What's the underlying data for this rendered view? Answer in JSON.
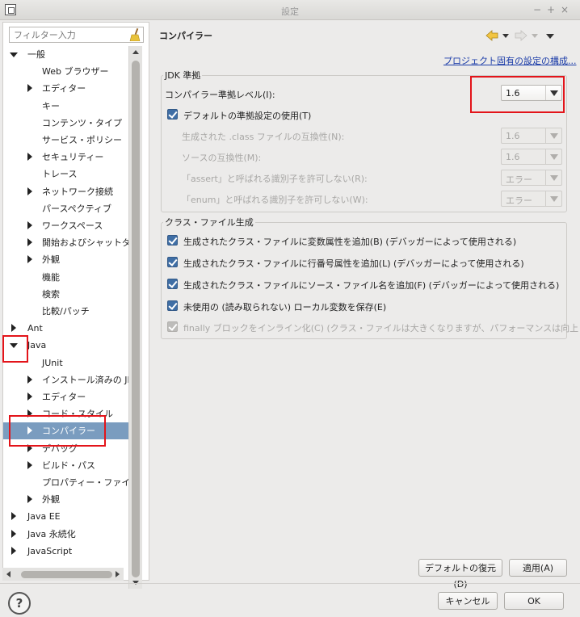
{
  "window": {
    "title": "設定",
    "controls": [
      "−",
      "+",
      "×"
    ]
  },
  "filter": {
    "placeholder": "フィルター入力"
  },
  "tree": [
    {
      "label": "一般",
      "level": 0,
      "state": "expanded"
    },
    {
      "label": "Web ブラウザー",
      "level": 1,
      "state": "none"
    },
    {
      "label": "エディター",
      "level": 1,
      "state": "collapsed"
    },
    {
      "label": "キー",
      "level": 1,
      "state": "none"
    },
    {
      "label": "コンテンツ・タイプ",
      "level": 1,
      "state": "none"
    },
    {
      "label": "サービス・ポリシー",
      "level": 1,
      "state": "none"
    },
    {
      "label": "セキュリティー",
      "level": 1,
      "state": "collapsed"
    },
    {
      "label": "トレース",
      "level": 1,
      "state": "none"
    },
    {
      "label": "ネットワーク接続",
      "level": 1,
      "state": "collapsed"
    },
    {
      "label": "パースペクティブ",
      "level": 1,
      "state": "none"
    },
    {
      "label": "ワークスペース",
      "level": 1,
      "state": "collapsed"
    },
    {
      "label": "開始およびシャットダウ",
      "level": 1,
      "state": "collapsed"
    },
    {
      "label": "外観",
      "level": 1,
      "state": "collapsed"
    },
    {
      "label": "機能",
      "level": 1,
      "state": "none"
    },
    {
      "label": "検索",
      "level": 1,
      "state": "none"
    },
    {
      "label": "比較/パッチ",
      "level": 1,
      "state": "none"
    },
    {
      "label": "Ant",
      "level": 0,
      "state": "collapsed"
    },
    {
      "label": "Java",
      "level": 0,
      "state": "expanded"
    },
    {
      "label": "JUnit",
      "level": 1,
      "state": "none"
    },
    {
      "label": "インストール済みの JR",
      "level": 1,
      "state": "collapsed"
    },
    {
      "label": "エディター",
      "level": 1,
      "state": "collapsed"
    },
    {
      "label": "コード・スタイル",
      "level": 1,
      "state": "collapsed"
    },
    {
      "label": "コンパイラー",
      "level": 1,
      "state": "collapsed",
      "selected": true
    },
    {
      "label": "デバッグ",
      "level": 1,
      "state": "collapsed"
    },
    {
      "label": "ビルド・パス",
      "level": 1,
      "state": "collapsed"
    },
    {
      "label": "プロパティー・ファイル・",
      "level": 1,
      "state": "none"
    },
    {
      "label": "外観",
      "level": 1,
      "state": "collapsed"
    },
    {
      "label": "Java EE",
      "level": 0,
      "state": "collapsed"
    },
    {
      "label": "Java 永続化",
      "level": 0,
      "state": "collapsed"
    },
    {
      "label": "JavaScript",
      "level": 0,
      "state": "collapsed"
    }
  ],
  "page": {
    "title": "コンパイラー",
    "project_link": "プロジェクト固有の設定の構成..."
  },
  "jdk": {
    "legend": "JDK 準拠",
    "compliance_label": "コンパイラー準拠レベル(I):",
    "compliance_value": "1.6",
    "use_default_label": "デフォルトの準拠設定の使用(T)",
    "rows": [
      {
        "label": "生成された .class ファイルの互換性(N):",
        "value": "1.6"
      },
      {
        "label": "ソースの互換性(M):",
        "value": "1.6"
      },
      {
        "label": "「assert」と呼ばれる識別子を許可しない(R):",
        "value": "エラー"
      },
      {
        "label": "「enum」と呼ばれる識別子を許可しない(W):",
        "value": "エラー"
      }
    ]
  },
  "classgen": {
    "legend": "クラス・ファイル生成",
    "options": [
      {
        "label": "生成されたクラス・ファイルに変数属性を追加(B) (デバッガーによって使用される)",
        "disabled": false
      },
      {
        "label": "生成されたクラス・ファイルに行番号属性を追加(L) (デバッガーによって使用される)",
        "disabled": false
      },
      {
        "label": "生成されたクラス・ファイルにソース・ファイル名を追加(F) (デバッガーによって使用される)",
        "disabled": false
      },
      {
        "label": "未使用の (読み取られない) ローカル変数を保存(E)",
        "disabled": false
      },
      {
        "label": "finally ブロックをインライン化(C) (クラス・ファイルは大きくなりますが、パフォーマンスは向上します)",
        "disabled": true
      }
    ]
  },
  "buttons": {
    "restore_defaults": "デフォルトの復元(D)",
    "apply": "適用(A)",
    "cancel": "キャンセル",
    "ok": "OK",
    "help": "?"
  }
}
